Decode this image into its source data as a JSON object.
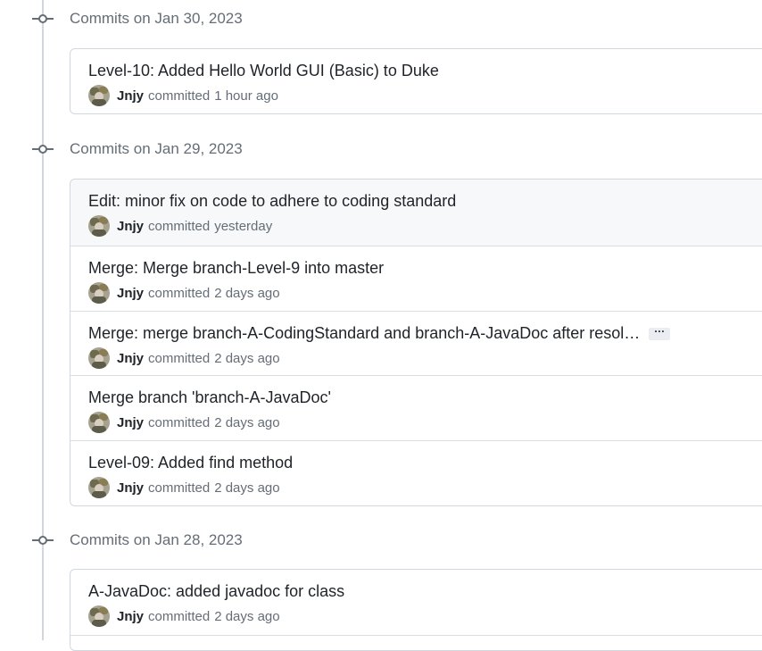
{
  "groups": [
    {
      "date_label": "Commits on Jan 30, 2023",
      "commits": [
        {
          "title": "Level-10: Added Hello World GUI (Basic) to Duke",
          "author": "Jnjy",
          "verb": "committed",
          "time": "1 hour ago"
        }
      ]
    },
    {
      "date_label": "Commits on Jan 29, 2023",
      "commits": [
        {
          "title": "Edit: minor fix on code to adhere to coding standard",
          "author": "Jnjy",
          "verb": "committed",
          "time": "yesterday"
        },
        {
          "title": "Merge: Merge branch-Level-9 into master",
          "author": "Jnjy",
          "verb": "committed",
          "time": "2 days ago"
        },
        {
          "title": "Merge: merge branch-A-CodingStandard and branch-A-JavaDoc after resol…",
          "ellipsis": "···",
          "author": "Jnjy",
          "verb": "committed",
          "time": "2 days ago"
        },
        {
          "title": "Merge branch 'branch-A-JavaDoc'",
          "author": "Jnjy",
          "verb": "committed",
          "time": "2 days ago"
        },
        {
          "title": "Level-09: Added find method",
          "author": "Jnjy",
          "verb": "committed",
          "time": "2 days ago"
        }
      ]
    },
    {
      "date_label": "Commits on Jan 28, 2023",
      "commits": [
        {
          "title": "A-JavaDoc: added javadoc for class",
          "author": "Jnjy",
          "verb": "committed",
          "time": "2 days ago"
        }
      ]
    }
  ],
  "icons": {
    "commit_node": "git-commit-icon",
    "avatar": "user-avatar"
  },
  "colors": {
    "muted_text": "#656d76",
    "border": "#d0d7de",
    "highlight_row": "#f6f8fa"
  }
}
